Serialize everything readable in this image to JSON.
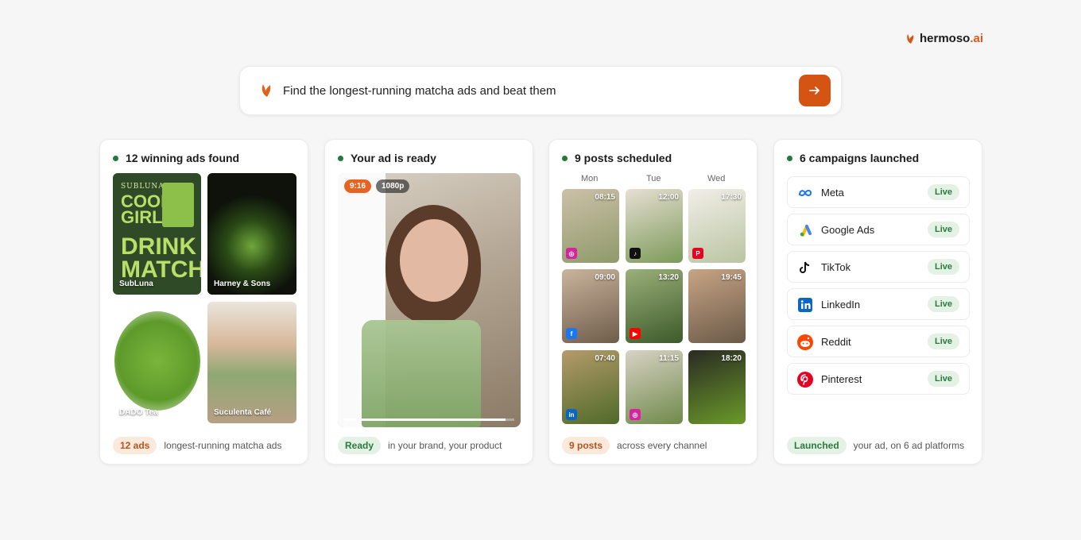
{
  "brand": {
    "name": "hermoso",
    "suffix": ".ai",
    "icon": "leaf-icon"
  },
  "search": {
    "query": "Find the longest-running matcha ads and beat them",
    "submit_icon": "arrow-right-icon"
  },
  "cards": {
    "ads": {
      "title": "12 winning ads found",
      "tiles": [
        "SubLuna",
        "Harney & Sons",
        "DADO Tea",
        "Suculenta Café"
      ],
      "subluna_art": {
        "brand": "SUBLUNA",
        "line1": "COOL",
        "line2": "GIRLS",
        "line3": "DRINK",
        "line4": "MATCHA"
      },
      "pill": "12 ads",
      "footer": "longest-running matcha ads"
    },
    "video": {
      "title": "Your ad is ready",
      "ratio": "9:16",
      "resolution": "1080p",
      "progress": 0.95,
      "pill": "Ready",
      "footer": "in your brand, your product"
    },
    "schedule": {
      "title": "9 posts scheduled",
      "days": [
        "Mon",
        "Tue",
        "Wed"
      ],
      "posts": [
        {
          "time": "08:15",
          "channel": "instagram"
        },
        {
          "time": "12:00",
          "channel": "tiktok"
        },
        {
          "time": "17:30",
          "channel": "pinterest"
        },
        {
          "time": "09:00",
          "channel": "facebook"
        },
        {
          "time": "13:20",
          "channel": "youtube"
        },
        {
          "time": "19:45",
          "channel": ""
        },
        {
          "time": "07:40",
          "channel": "linkedin"
        },
        {
          "time": "11:15",
          "channel": "instagram"
        },
        {
          "time": "18:20",
          "channel": ""
        }
      ],
      "pill": "9 posts",
      "footer": "across every channel"
    },
    "campaigns": {
      "title": "6 campaigns launched",
      "platforms": [
        {
          "name": "Meta",
          "status": "Live",
          "icon": "meta-icon"
        },
        {
          "name": "Google Ads",
          "status": "Live",
          "icon": "google-ads-icon"
        },
        {
          "name": "TikTok",
          "status": "Live",
          "icon": "tiktok-icon"
        },
        {
          "name": "LinkedIn",
          "status": "Live",
          "icon": "linkedin-icon"
        },
        {
          "name": "Reddit",
          "status": "Live",
          "icon": "reddit-icon"
        },
        {
          "name": "Pinterest",
          "status": "Live",
          "icon": "pinterest-icon"
        }
      ],
      "pill": "Launched",
      "footer": "your ad, on 6 ad platforms"
    }
  },
  "colors": {
    "accent": "#d65413",
    "status_green": "#1f7a3c"
  }
}
